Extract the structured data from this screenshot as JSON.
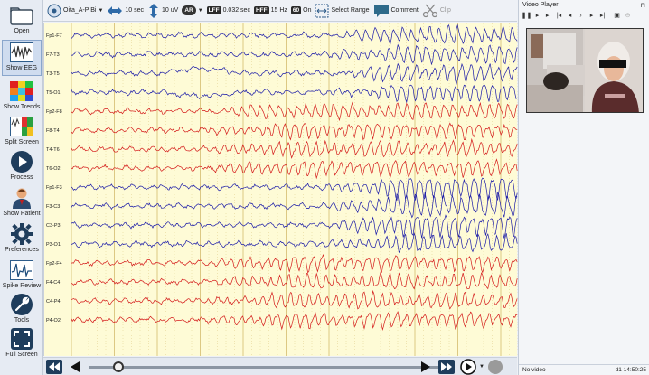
{
  "left_toolbar": {
    "items": [
      {
        "key": "open",
        "label": "Open",
        "icon": "folder-icon"
      },
      {
        "key": "show_eeg",
        "label": "Show EEG",
        "icon": "eeg-wave-icon",
        "active": true
      },
      {
        "key": "show_trends",
        "label": "Show Trends",
        "icon": "trends-heatmap-icon"
      },
      {
        "key": "split_screen",
        "label": "Split Screen",
        "icon": "split-screen-icon"
      },
      {
        "key": "process",
        "label": "Process",
        "icon": "play-circle-icon"
      },
      {
        "key": "show_patient",
        "label": "Show Patient",
        "icon": "patient-icon"
      },
      {
        "key": "preferences",
        "label": "Preferences",
        "icon": "gear-icon"
      },
      {
        "key": "spike_review",
        "label": "Spike Review",
        "icon": "spike-review-icon"
      },
      {
        "key": "tools",
        "label": "Tools",
        "icon": "wrench-icon"
      },
      {
        "key": "full_screen",
        "label": "Full Screen",
        "icon": "full-screen-icon"
      }
    ]
  },
  "top_toolbar": {
    "montage": "Oita_A-P Bi",
    "timebase": "10 sec",
    "sensitivity": "10 uV",
    "ar_badge": "AR",
    "lff_badge": "LFF",
    "lff_value": "0.032 sec",
    "hff_badge": "HFF",
    "hff_value": "15 Hz",
    "notch_badge": "60",
    "notch_value": "On",
    "select_range": "Select Range",
    "comment": "Comment",
    "clip": "Clip"
  },
  "eeg": {
    "channels": [
      {
        "label": "Fp1-F7",
        "color": "#1a1aa8",
        "hemisphere": "left"
      },
      {
        "label": "F7-T3",
        "color": "#1a1aa8",
        "hemisphere": "left"
      },
      {
        "label": "T3-T5",
        "color": "#1a1aa8",
        "hemisphere": "left"
      },
      {
        "label": "T5-O1",
        "color": "#1a1aa8",
        "hemisphere": "left"
      },
      {
        "label": "Fp2-F8",
        "color": "#d41919",
        "hemisphere": "right"
      },
      {
        "label": "F8-T4",
        "color": "#d41919",
        "hemisphere": "right"
      },
      {
        "label": "T4-T6",
        "color": "#d41919",
        "hemisphere": "right"
      },
      {
        "label": "T6-O2",
        "color": "#d41919",
        "hemisphere": "right"
      },
      {
        "label": "Fp1-F3",
        "color": "#1a1aa8",
        "hemisphere": "left"
      },
      {
        "label": "F3-C3",
        "color": "#1a1aa8",
        "hemisphere": "left"
      },
      {
        "label": "C3-P3",
        "color": "#1a1aa8",
        "hemisphere": "left"
      },
      {
        "label": "P3-O1",
        "color": "#1a1aa8",
        "hemisphere": "left"
      },
      {
        "label": "Fp2-F4",
        "color": "#d41919",
        "hemisphere": "right"
      },
      {
        "label": "F4-C4",
        "color": "#d41919",
        "hemisphere": "right"
      },
      {
        "label": "C4-P4",
        "color": "#d41919",
        "hemisphere": "right"
      },
      {
        "label": "P4-O2",
        "color": "#d41919",
        "hemisphere": "right"
      }
    ],
    "background_color": "#fefbd6",
    "gridline_color": "#d9c37a"
  },
  "video_panel": {
    "title": "Video Player",
    "status_left": "No video",
    "status_right": "d1 14:50:25"
  }
}
